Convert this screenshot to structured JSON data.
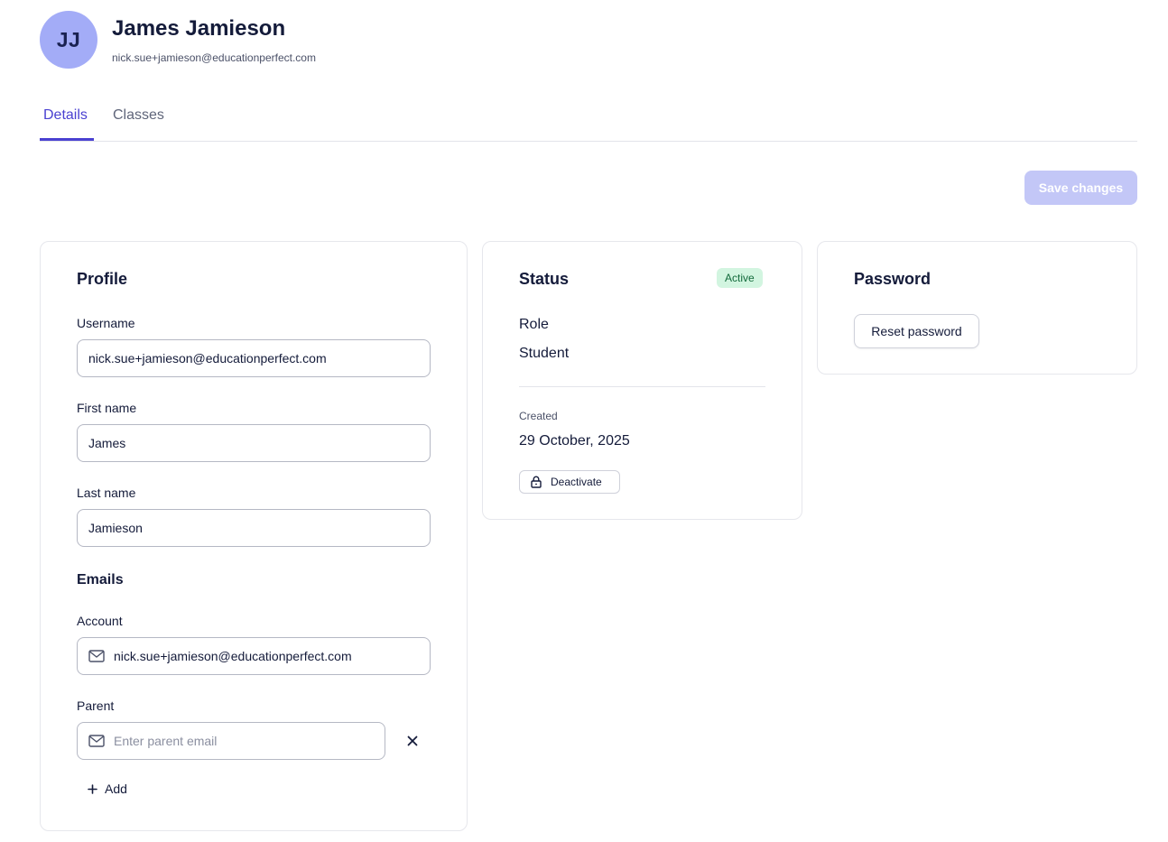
{
  "user": {
    "initials": "JJ",
    "name": "James Jamieson",
    "email": "nick.sue+jamieson@educationperfect.com"
  },
  "tabs": [
    {
      "label": "Details",
      "active": true
    },
    {
      "label": "Classes",
      "active": false
    }
  ],
  "actions": {
    "save_label": "Save changes"
  },
  "profile": {
    "title": "Profile",
    "username_label": "Username",
    "username_value": "nick.sue+jamieson@educationperfect.com",
    "first_name_label": "First name",
    "first_name_value": "James",
    "last_name_label": "Last name",
    "last_name_value": "Jamieson",
    "emails_title": "Emails",
    "account_label": "Account",
    "account_value": "nick.sue+jamieson@educationperfect.com",
    "parent_label": "Parent",
    "parent_placeholder": "Enter parent email",
    "add_label": "Add"
  },
  "status": {
    "title": "Status",
    "badge": "Active",
    "role_label": "Role",
    "role_value": "Student",
    "created_label": "Created",
    "created_value": "29 October, 2025",
    "deactivate_label": "Deactivate"
  },
  "password": {
    "title": "Password",
    "reset_label": "Reset password"
  },
  "colors": {
    "accent": "#4a41d1",
    "avatar_bg": "#a3acf7",
    "save_disabled_bg": "#c3c7f7",
    "badge_bg": "#d2f5e0",
    "badge_text": "#126a3b"
  },
  "icons": {
    "account_email": "mail-icon",
    "parent_email": "mail-icon",
    "remove": "close-icon",
    "add": "plus-icon",
    "deactivate": "lock-icon"
  }
}
